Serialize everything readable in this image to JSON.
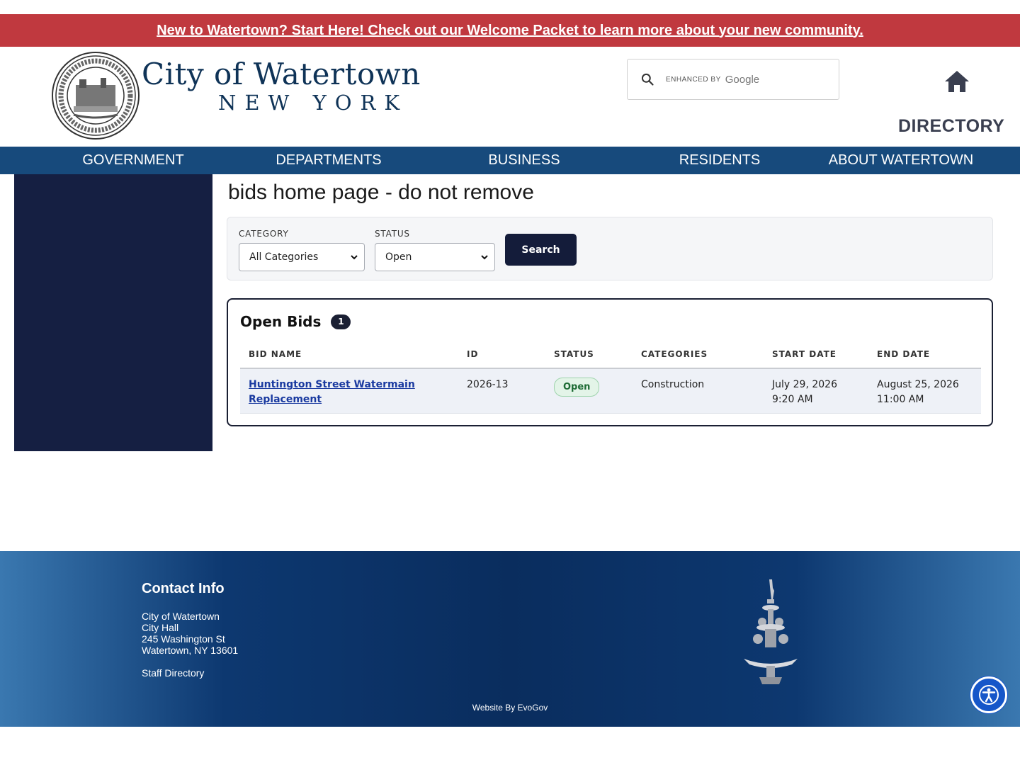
{
  "banner": {
    "text": "New to Watertown? Start Here! Check out our Welcome Packet to learn more about your new community."
  },
  "header": {
    "title": "City of Watertown",
    "subtitle": "NEW YORK",
    "search_enhanced": "ENHANCED BY",
    "search_brand": "Google",
    "directory_label": "DIRECTORY"
  },
  "nav": {
    "items": [
      {
        "label": "GOVERNMENT"
      },
      {
        "label": "DEPARTMENTS"
      },
      {
        "label": "BUSINESS"
      },
      {
        "label": "RESIDENTS"
      },
      {
        "label": "ABOUT WATERTOWN"
      }
    ]
  },
  "main": {
    "page_title": "bids home page - do not remove",
    "filters": {
      "category_label": "CATEGORY",
      "category_value": "All Categories",
      "status_label": "STATUS",
      "status_value": "Open",
      "search_button": "Search"
    },
    "bids": {
      "title": "Open Bids",
      "count": "1",
      "columns": [
        "BID NAME",
        "ID",
        "STATUS",
        "CATEGORIES",
        "START DATE",
        "END DATE"
      ],
      "rows": [
        {
          "name_line1": "Huntington Street Watermain",
          "name_line2": "Replacement",
          "id": "2026-13",
          "status": "Open",
          "categories": "Construction",
          "start_date": "July 29, 2026",
          "start_time": "9:20 AM",
          "end_date": "August 25, 2026",
          "end_time": "11:00 AM"
        }
      ]
    }
  },
  "footer": {
    "contact_title": "Contact Info",
    "lines": [
      "City of Watertown",
      "City Hall",
      "245 Washington St",
      "Watertown, NY 13601"
    ],
    "staff_directory": "Staff Directory",
    "credit": "Website By EvoGov"
  },
  "colors": {
    "banner": "#c0393f",
    "nav": "#174a7c",
    "sidebar": "#151f42",
    "primary_button": "#141c3a",
    "accessibility": "#1656c9"
  }
}
